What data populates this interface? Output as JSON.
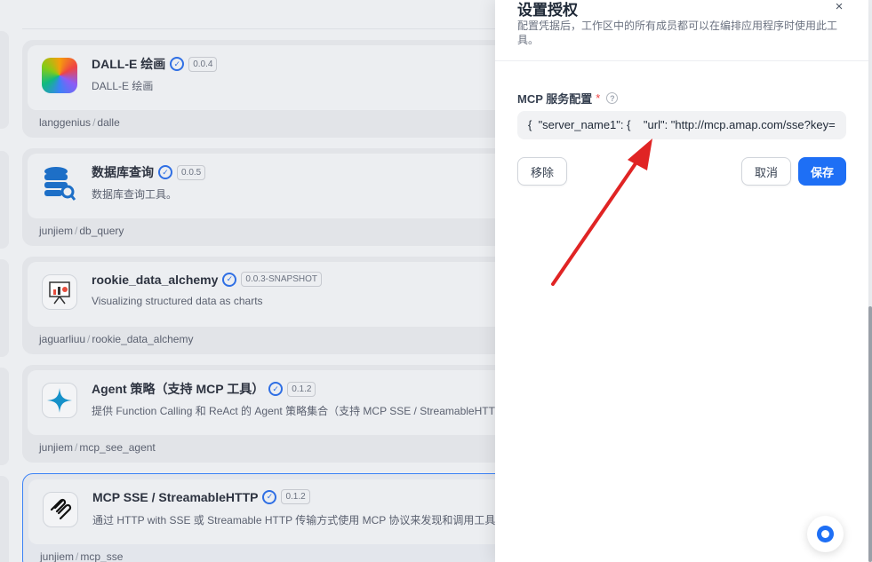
{
  "tools": [
    {
      "name": "DALL-E 绘画",
      "version": "0.0.4",
      "description": "DALL-E 绘画",
      "author": "langgenius",
      "slug": "dalle",
      "icon": "dalle-icon"
    },
    {
      "name": "数据库查询",
      "version": "0.0.5",
      "description": "数据库查询工具。",
      "author": "junjiem",
      "slug": "db_query",
      "icon": "database-icon"
    },
    {
      "name": "rookie_data_alchemy",
      "version": "0.0.3-SNAPSHOT",
      "description": "Visualizing structured data as charts",
      "author": "jaguarliuu",
      "slug": "rookie_data_alchemy",
      "icon": "chart-board-icon"
    },
    {
      "name": "Agent 策略（支持 MCP 工具）",
      "version": "0.1.2",
      "description": "提供 Function Calling 和 ReAct 的 Agent 策略集合（支持 MCP SSE / StreamableHTTP",
      "author": "junjiem",
      "slug": "mcp_see_agent",
      "icon": "sparkle-icon"
    },
    {
      "name": "MCP SSE / StreamableHTTP",
      "version": "0.1.2",
      "description": "通过 HTTP with SSE 或 Streamable HTTP 传输方式使用 MCP 协议来发现和调用工具。",
      "author": "junjiem",
      "slug": "mcp_sse",
      "icon": "mcp-icon"
    }
  ],
  "drawer": {
    "title": "设置授权",
    "subtitle": "配置凭据后，工作区中的所有成员都可以在编排应用程序时使用此工具。",
    "close_icon": "×",
    "field_label": "MCP 服务配置",
    "required_mark": "*",
    "help_icon": "?",
    "config_value": "{  \"server_name1\": {    \"url\": \"http://mcp.amap.com/sse?key=",
    "remove_label": "移除",
    "cancel_label": "取消",
    "save_label": "保存"
  },
  "colors": {
    "primary": "#1e6ff5",
    "arrow": "#e02424",
    "required": "#ef4444"
  }
}
